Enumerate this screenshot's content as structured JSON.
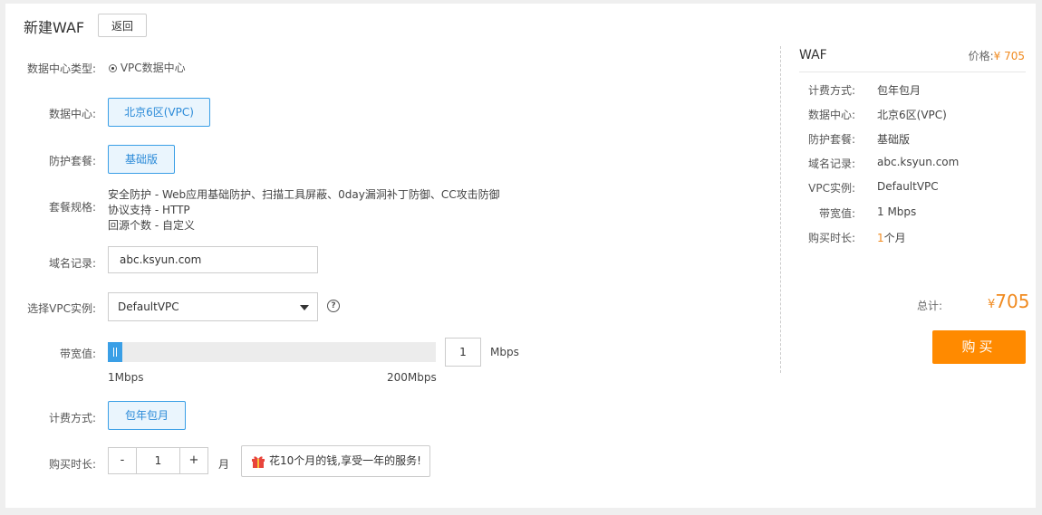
{
  "header": {
    "title": "新建WAF",
    "back_label": "返回"
  },
  "form": {
    "dc_type_label": "数据中心类型:",
    "dc_type_option": "VPC数据中心",
    "dc_label": "数据中心:",
    "dc_value": "北京6区(VPC)",
    "package_label": "防护套餐:",
    "package_value": "基础版",
    "spec_label": "套餐规格:",
    "spec_lines": [
      "安全防护 - Web应用基础防护、扫描工具屏蔽、0day漏洞补丁防御、CC攻击防御",
      "协议支持 - HTTP",
      "回源个数 - 自定义"
    ],
    "domain_label": "域名记录:",
    "domain_value": "abc.ksyun.com",
    "vpc_label": "选择VPC实例:",
    "vpc_value": "DefaultVPC",
    "help_glyph": "?",
    "bandwidth_label": "带宽值:",
    "bandwidth_value": "1",
    "bandwidth_unit": "Mbps",
    "bandwidth_level": 0,
    "bandwidth_min": "1Mbps",
    "bandwidth_max": "200Mbps",
    "billing_label": "计费方式:",
    "billing_value": "包年包月",
    "duration_label": "购买时长:",
    "duration_minus": "-",
    "duration_value": "1",
    "duration_plus": "+",
    "duration_unit": "月",
    "promo_text": "花10个月的钱,享受一年的服务!"
  },
  "summary": {
    "title": "WAF",
    "price_label": "价格:",
    "price_value": "¥ 705",
    "rows": [
      {
        "label": "计费方式:",
        "value": "包年包月"
      },
      {
        "label": "数据中心:",
        "value": "北京6区(VPC)"
      },
      {
        "label": "防护套餐:",
        "value": "基础版"
      },
      {
        "label": "域名记录:",
        "value": "abc.ksyun.com"
      },
      {
        "label": "VPC实例:",
        "value": "DefaultVPC"
      },
      {
        "label": "带宽值:",
        "value": "1 Mbps"
      }
    ],
    "duration_label": "购买时长:",
    "duration_num": "1",
    "duration_unit": "个月",
    "total_label": "总计:",
    "total_currency": "¥",
    "total_value": "705",
    "buy_label": "购买"
  },
  "colors": {
    "accent": "#3a9fe6",
    "orange": "#ff8a00",
    "price": "#f08a1f"
  }
}
